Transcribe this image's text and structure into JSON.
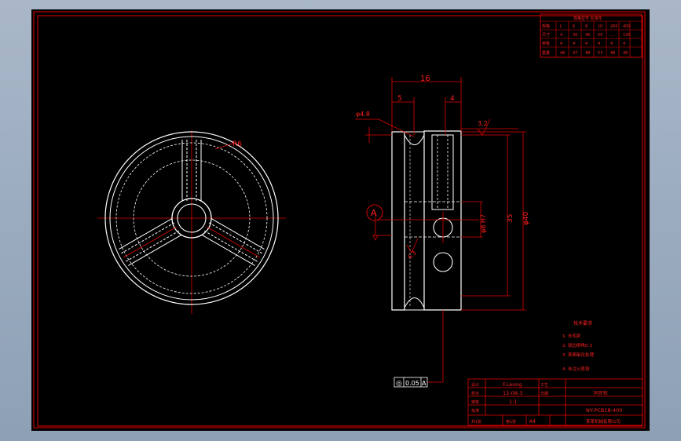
{
  "dimensions": {
    "width_16": "16",
    "width_5": "5",
    "width_4": "4",
    "phi_4_8": "φ4.8",
    "phi_8_h7": "φ8 H7",
    "dim_35": "35",
    "phi_40": "φ40",
    "r6": "R6",
    "roughness_top": "3.2",
    "roughness_side": "6.3",
    "datum": "A"
  },
  "tolerance": {
    "symbol": "◎",
    "value": "0.05",
    "datum": "A"
  },
  "parameter_table": {
    "title": "规格型号 标准件",
    "rows": [
      [
        "规格",
        "L",
        "6",
        "8",
        "10",
        "200",
        "400"
      ],
      [
        "尺寸",
        "4",
        "35",
        "45",
        "55",
        "...",
        "130"
      ],
      [
        "参数",
        "4",
        "4",
        "4",
        "4",
        "4",
        "4"
      ],
      [
        "重量",
        "46",
        "47",
        "48",
        "53",
        "48",
        "48"
      ]
    ]
  },
  "notes": {
    "title": "技术要求",
    "items": [
      "1. 去毛刺",
      "2. 锐边倒角0.3",
      "3. 表面氧化处理",
      "4. 未注公差按"
    ]
  },
  "title_block": {
    "designer": "F.Leong",
    "date": "12-08-3",
    "scale": "1:1",
    "part_name": "同步轮",
    "drawing_no": "NY-PCB18-400",
    "company": "某某机械有限公司",
    "sheet": "A4",
    "labels": [
      "设计",
      "校对",
      "审核",
      "批准",
      "工艺",
      "日期"
    ],
    "bottom_labels": [
      "共1张",
      "第1张"
    ]
  }
}
